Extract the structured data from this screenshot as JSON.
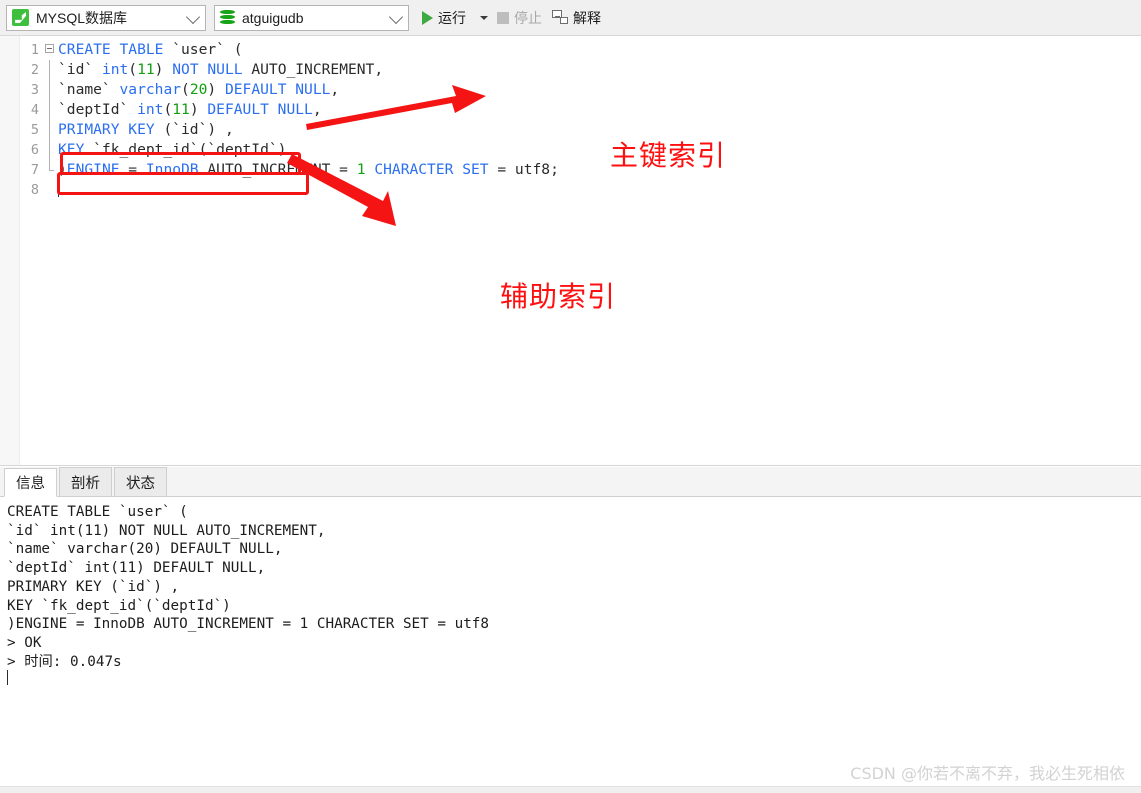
{
  "toolbar": {
    "db_type": {
      "label": "MYSQL数据库",
      "icon": "mysql-logo-icon"
    },
    "db_name": {
      "label": "atguigudb",
      "icon": "database-icon"
    },
    "run": {
      "label": "运行",
      "icon": "play-icon",
      "has_dropdown": true
    },
    "stop": {
      "label": "停止",
      "icon": "stop-square-icon",
      "disabled": true
    },
    "explain": {
      "label": "解释",
      "icon": "explain-diagram-icon"
    }
  },
  "editor": {
    "line_numbers": [
      "1",
      "2",
      "3",
      "4",
      "5",
      "6",
      "7",
      "8"
    ],
    "lines": [
      [
        {
          "t": "CREATE TABLE ",
          "c": "kw"
        },
        {
          "t": "`user` (",
          "c": "pln"
        }
      ],
      [
        {
          "t": "`id` ",
          "c": "pln"
        },
        {
          "t": "int",
          "c": "kw"
        },
        {
          "t": "(",
          "c": "pln"
        },
        {
          "t": "11",
          "c": "num"
        },
        {
          "t": ") ",
          "c": "pln"
        },
        {
          "t": "NOT NULL",
          "c": "kw"
        },
        {
          "t": " AUTO_INCREMENT,",
          "c": "pln"
        }
      ],
      [
        {
          "t": "`name` ",
          "c": "pln"
        },
        {
          "t": "varchar",
          "c": "kw"
        },
        {
          "t": "(",
          "c": "pln"
        },
        {
          "t": "20",
          "c": "num"
        },
        {
          "t": ") ",
          "c": "pln"
        },
        {
          "t": "DEFAULT NULL",
          "c": "kw"
        },
        {
          "t": ",",
          "c": "pln"
        }
      ],
      [
        {
          "t": "`deptId` ",
          "c": "pln"
        },
        {
          "t": "int",
          "c": "kw"
        },
        {
          "t": "(",
          "c": "pln"
        },
        {
          "t": "11",
          "c": "num"
        },
        {
          "t": ") ",
          "c": "pln"
        },
        {
          "t": "DEFAULT NULL",
          "c": "kw"
        },
        {
          "t": ",",
          "c": "pln"
        }
      ],
      [
        {
          "t": "PRIMARY KEY",
          "c": "kw"
        },
        {
          "t": " (`id`) ,",
          "c": "pln"
        }
      ],
      [
        {
          "t": "KEY",
          "c": "kw"
        },
        {
          "t": " `fk_dept_id`(`deptId`)",
          "c": "pln"
        }
      ],
      [
        {
          "t": ")",
          "c": "pln"
        },
        {
          "t": "ENGINE",
          "c": "kw"
        },
        {
          "t": " = ",
          "c": "pln"
        },
        {
          "t": "InnoDB",
          "c": "kw"
        },
        {
          "t": " AUTO_INCREMENT = ",
          "c": "pln"
        },
        {
          "t": "1",
          "c": "num"
        },
        {
          "t": " CHARACTER SET",
          "c": "kw"
        },
        {
          "t": " = utf8;",
          "c": "pln"
        }
      ],
      []
    ]
  },
  "annotations": {
    "primary_index": "主键索引",
    "secondary_index": "辅助索引"
  },
  "result": {
    "tabs": [
      {
        "label": "信息",
        "active": true
      },
      {
        "label": "剖析",
        "active": false
      },
      {
        "label": "状态",
        "active": false
      }
    ],
    "log": "CREATE TABLE `user` (\n`id` int(11) NOT NULL AUTO_INCREMENT,\n`name` varchar(20) DEFAULT NULL,\n`deptId` int(11) DEFAULT NULL,\nPRIMARY KEY (`id`) ,\nKEY `fk_dept_id`(`deptId`)\n)ENGINE = InnoDB AUTO_INCREMENT = 1 CHARACTER SET = utf8\n> OK\n> 时间: 0.047s"
  },
  "watermark": "CSDN @你若不离不弃，我必生死相依",
  "colors": {
    "keyword": "#2b6ff0",
    "number": "#11a011",
    "annotation_red": "#ff1010",
    "accent_green": "#3faa3f"
  }
}
